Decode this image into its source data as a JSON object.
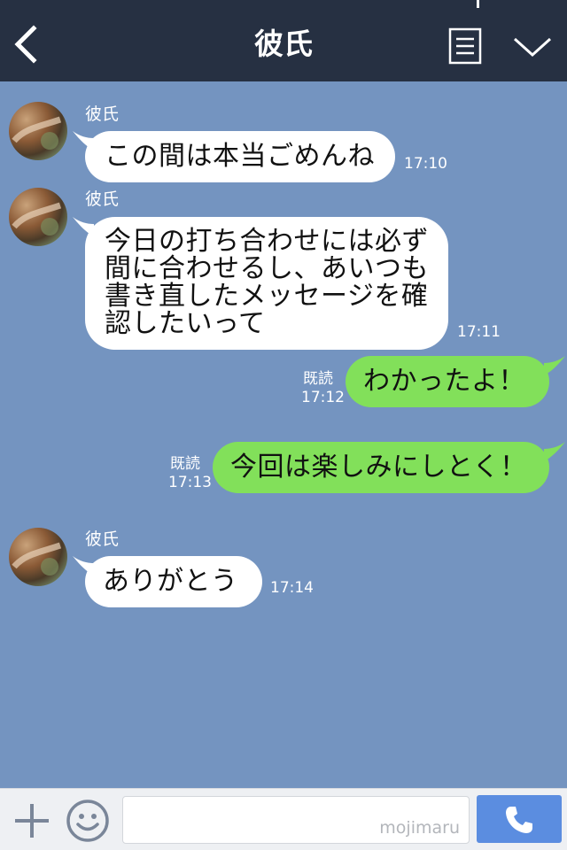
{
  "header": {
    "title": "彼氏",
    "back_icon": "chevron-left-icon",
    "menu_icon": "document-list-icon",
    "expand_icon": "chevron-down-icon",
    "background": "#263042"
  },
  "chat": {
    "background": "#7494c0",
    "incoming_bubble_color": "#ffffff",
    "outgoing_bubble_color": "#82e05a",
    "messages": [
      {
        "direction": "incoming",
        "sender": "彼氏",
        "text": "この間は本当ごめんね",
        "time": "17:10"
      },
      {
        "direction": "incoming",
        "sender": "彼氏",
        "text": "今日の打ち合わせには必ず\n間に合わせるし、あいつも\n書き直したメッセージを確\n認したいって",
        "time": "17:11"
      },
      {
        "direction": "outgoing",
        "read": "既読",
        "text": "わかったよ！",
        "time": "17:12"
      },
      {
        "direction": "outgoing",
        "read": "既読",
        "text": "今回は楽しみにしとく！",
        "time": "17:13"
      },
      {
        "direction": "incoming",
        "sender": "彼氏",
        "text": "ありがとう",
        "time": "17:14"
      }
    ]
  },
  "input_bar": {
    "plus_icon": "plus-icon",
    "emoji_icon": "smiley-icon",
    "input_value": "",
    "watermark": "mojimaru",
    "call_icon": "phone-icon",
    "call_button_color": "#5b8de0"
  }
}
